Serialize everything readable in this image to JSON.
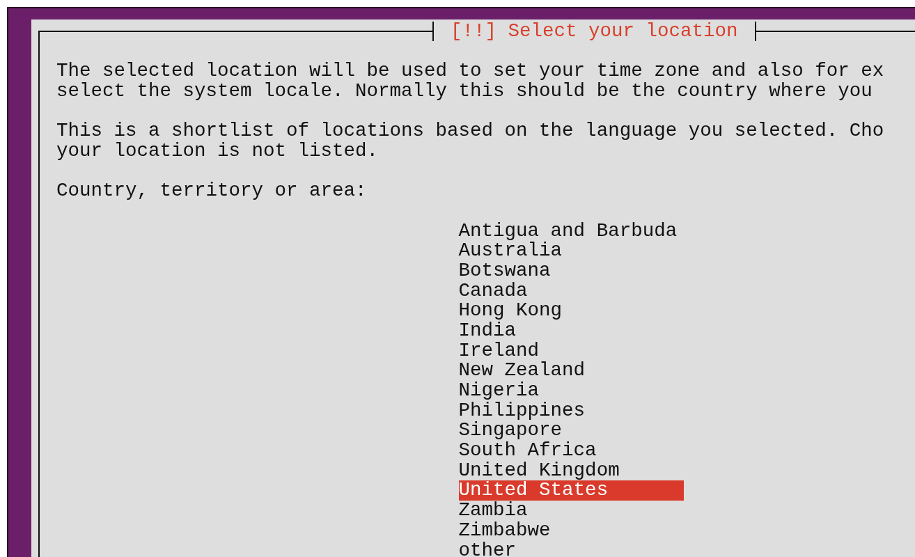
{
  "dialog": {
    "title": "[!!] Select your location"
  },
  "paragraphs": [
    {
      "lines": [
        "The selected location will be used to set your time zone and also for ex",
        "select the system locale. Normally this should be the country where you"
      ]
    },
    {
      "lines": [
        "This is a shortlist of locations based on the language you selected. Cho",
        "your location is not listed."
      ]
    }
  ],
  "prompt": "Country, territory or area:",
  "options": [
    {
      "label": "Antigua and Barbuda",
      "selected": false
    },
    {
      "label": "Australia",
      "selected": false
    },
    {
      "label": "Botswana",
      "selected": false
    },
    {
      "label": "Canada",
      "selected": false
    },
    {
      "label": "Hong Kong",
      "selected": false
    },
    {
      "label": "India",
      "selected": false
    },
    {
      "label": "Ireland",
      "selected": false
    },
    {
      "label": "New Zealand",
      "selected": false
    },
    {
      "label": "Nigeria",
      "selected": false
    },
    {
      "label": "Philippines",
      "selected": false
    },
    {
      "label": "Singapore",
      "selected": false
    },
    {
      "label": "South Africa",
      "selected": false
    },
    {
      "label": "United Kingdom",
      "selected": false
    },
    {
      "label": "United States",
      "selected": true
    },
    {
      "label": "Zambia",
      "selected": false
    },
    {
      "label": "Zimbabwe",
      "selected": false
    },
    {
      "label": "other",
      "selected": false
    }
  ]
}
